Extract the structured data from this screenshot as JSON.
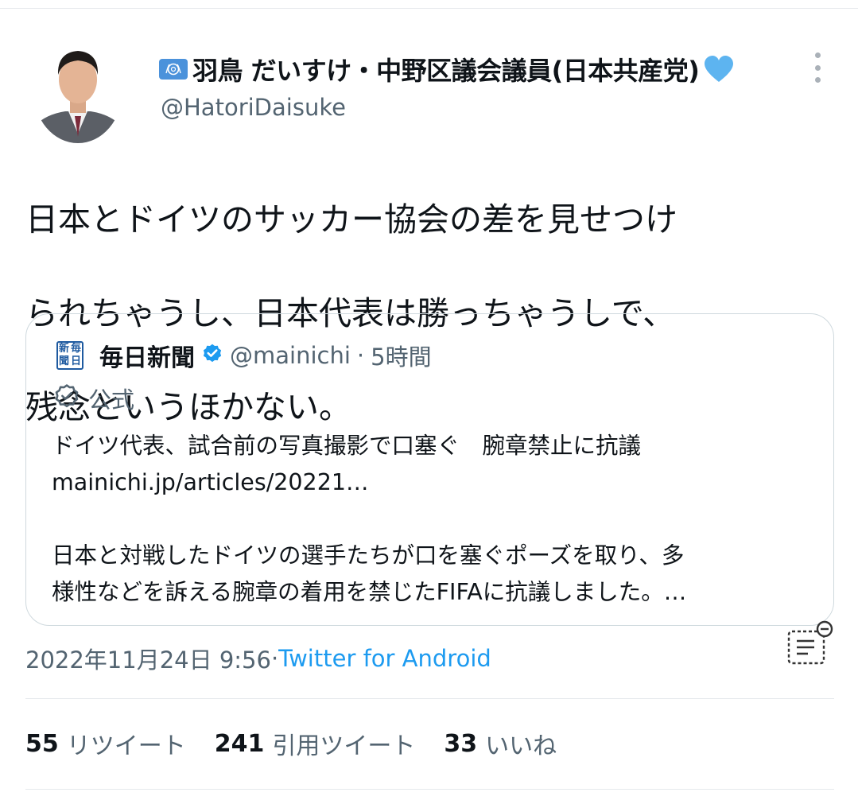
{
  "author": {
    "flag_icon": "united-nations-flag",
    "display_name": "羽鳥 だいすけ・中野区議会議員(日本共産党)",
    "name_emoji": "blue-heart",
    "handle": "@HatoriDaisuke"
  },
  "tweet": {
    "text_lines": [
      "日本とドイツのサッカー協会の差を見せつけ",
      "られちゃうし、日本代表は勝っちゃうしで、",
      "残念というほかない。"
    ],
    "timestamp": "2022年11月24日 9:56",
    "separator": " · ",
    "source": "Twitter for Android"
  },
  "quote": {
    "logo_chars": [
      "新",
      "毎",
      "聞",
      "日"
    ],
    "name": "毎日新聞",
    "handle": "@mainichi",
    "separator": " · ",
    "time_ago": "5時間",
    "official_label": "公式",
    "line1": "ドイツ代表、試合前の写真撮影で口塞ぐ　腕章禁止に抗議",
    "line2": "mainichi.jp/articles/20221…",
    "line3": "日本と対戦したドイツの選手たちが口を塞ぐポーズを取り、多",
    "line4": "様性などを訴える腕章の着用を禁じたFIFAに抗議しました。…"
  },
  "stats": {
    "retweets_count": "55",
    "retweets_label": "リツイート",
    "quotes_count": "241",
    "quotes_label": "引用ツイート",
    "likes_count": "33",
    "likes_label": "いいね"
  },
  "colors": {
    "verified": "#1d9bf0",
    "link": "#1d9bf0",
    "secondary_text": "#536471",
    "heart": "#5db4f0"
  }
}
